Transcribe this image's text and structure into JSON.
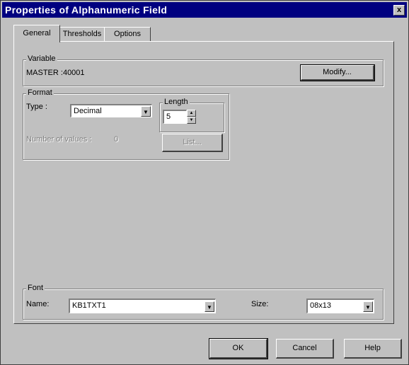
{
  "window": {
    "title": "Properties of Alphanumeric Field",
    "close_glyph": "x"
  },
  "tabs": [
    {
      "label": "General",
      "active": true
    },
    {
      "label": "Thresholds",
      "active": false
    },
    {
      "label": "Options",
      "active": false
    }
  ],
  "variable": {
    "group_label": "Variable",
    "value": "MASTER :40001",
    "modify_label": "Modify..."
  },
  "format": {
    "group_label": "Format",
    "type_label": "Type :",
    "type_value": "Decimal",
    "length_label": "Length",
    "length_value": "5",
    "num_values_label": "Number of values :",
    "num_values_value": "0",
    "list_label": "List..."
  },
  "font": {
    "group_label": "Font",
    "name_label": "Name:",
    "name_value": "KB1TXT1",
    "size_label": "Size:",
    "size_value": "08x13"
  },
  "footer": {
    "ok_label": "OK",
    "cancel_label": "Cancel",
    "help_label": "Help"
  },
  "colors": {
    "titlebar": "#000080",
    "face": "#c0c0c0"
  }
}
